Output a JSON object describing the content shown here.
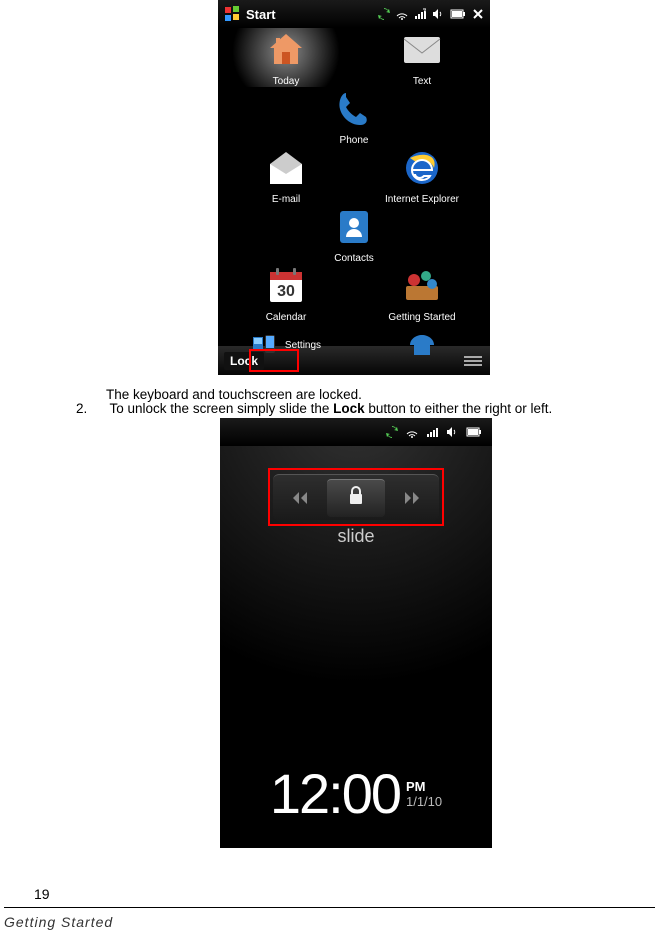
{
  "phone1": {
    "start": "Start",
    "apps": [
      {
        "label": "Today"
      },
      {
        "label": "Text"
      },
      {
        "label": "Phone"
      },
      {
        "label": "E-mail"
      },
      {
        "label": "Internet Explorer"
      },
      {
        "label": "Contacts"
      },
      {
        "label": "Calendar"
      },
      {
        "label": "Getting Started"
      },
      {
        "label": "Settings"
      }
    ],
    "calendar_day": "30",
    "lock": "Lock"
  },
  "caption1": "The keyboard and touchscreen are locked.",
  "step_num": "2.",
  "step_text_a": "To unlock the screen simply slide the ",
  "step_text_bold": "Lock",
  "step_text_b": " button to either the right or left.",
  "phone2": {
    "slide_label": "slide",
    "time": "12:00",
    "ampm": "PM",
    "date": "1/1/10"
  },
  "page_number": "19",
  "footer_title": "Getting Started"
}
